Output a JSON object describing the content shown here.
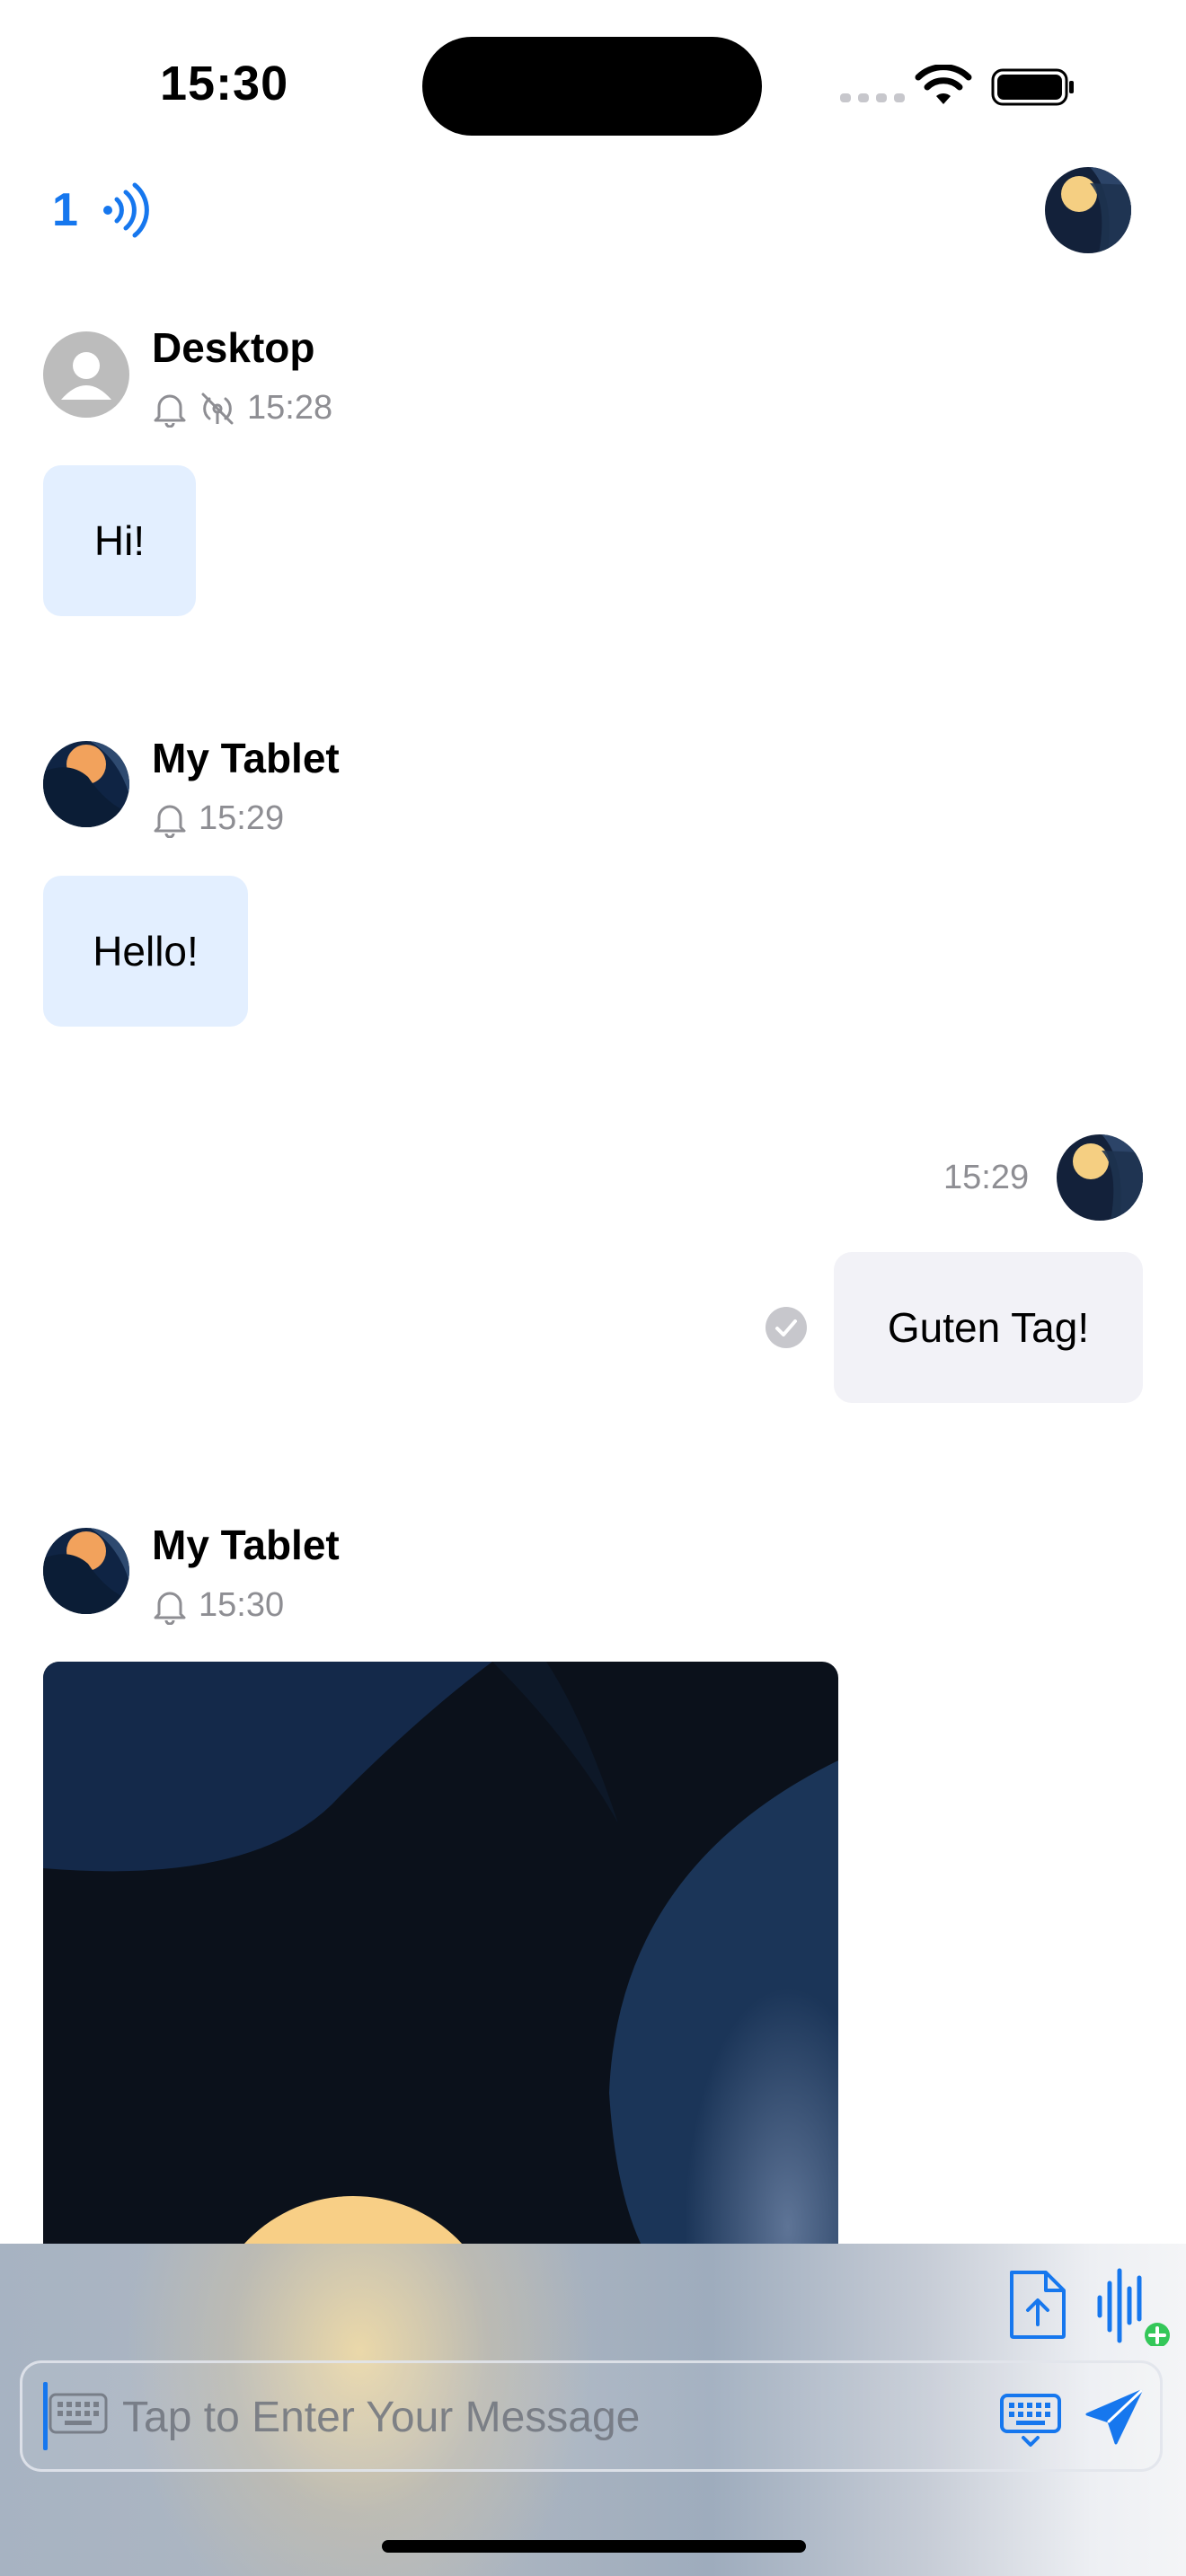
{
  "status_bar": {
    "time": "15:30"
  },
  "nav": {
    "online_count": "1"
  },
  "messages": [
    {
      "sender": "Desktop",
      "time": "15:28",
      "text": "Hi!"
    },
    {
      "sender": "My Tablet",
      "time": "15:29",
      "text": "Hello!"
    },
    {
      "sender": "",
      "time": "15:29",
      "text": "Guten Tag!"
    },
    {
      "sender": "My Tablet",
      "time": "15:30",
      "text": ""
    }
  ],
  "composer": {
    "placeholder": "Tap to Enter Your Message"
  },
  "colors": {
    "accent": "#1677ee",
    "bubble_in": "#e3efff",
    "bubble_out": "#f2f2f7",
    "sent_check": "#c7c7cc"
  },
  "icons": [
    "wifi-icon",
    "battery-icon",
    "broadcast-icon",
    "bell-icon",
    "no-signal-icon",
    "check-icon",
    "file-upload-icon",
    "voice-add-icon",
    "keyboard-icon",
    "send-icon"
  ]
}
